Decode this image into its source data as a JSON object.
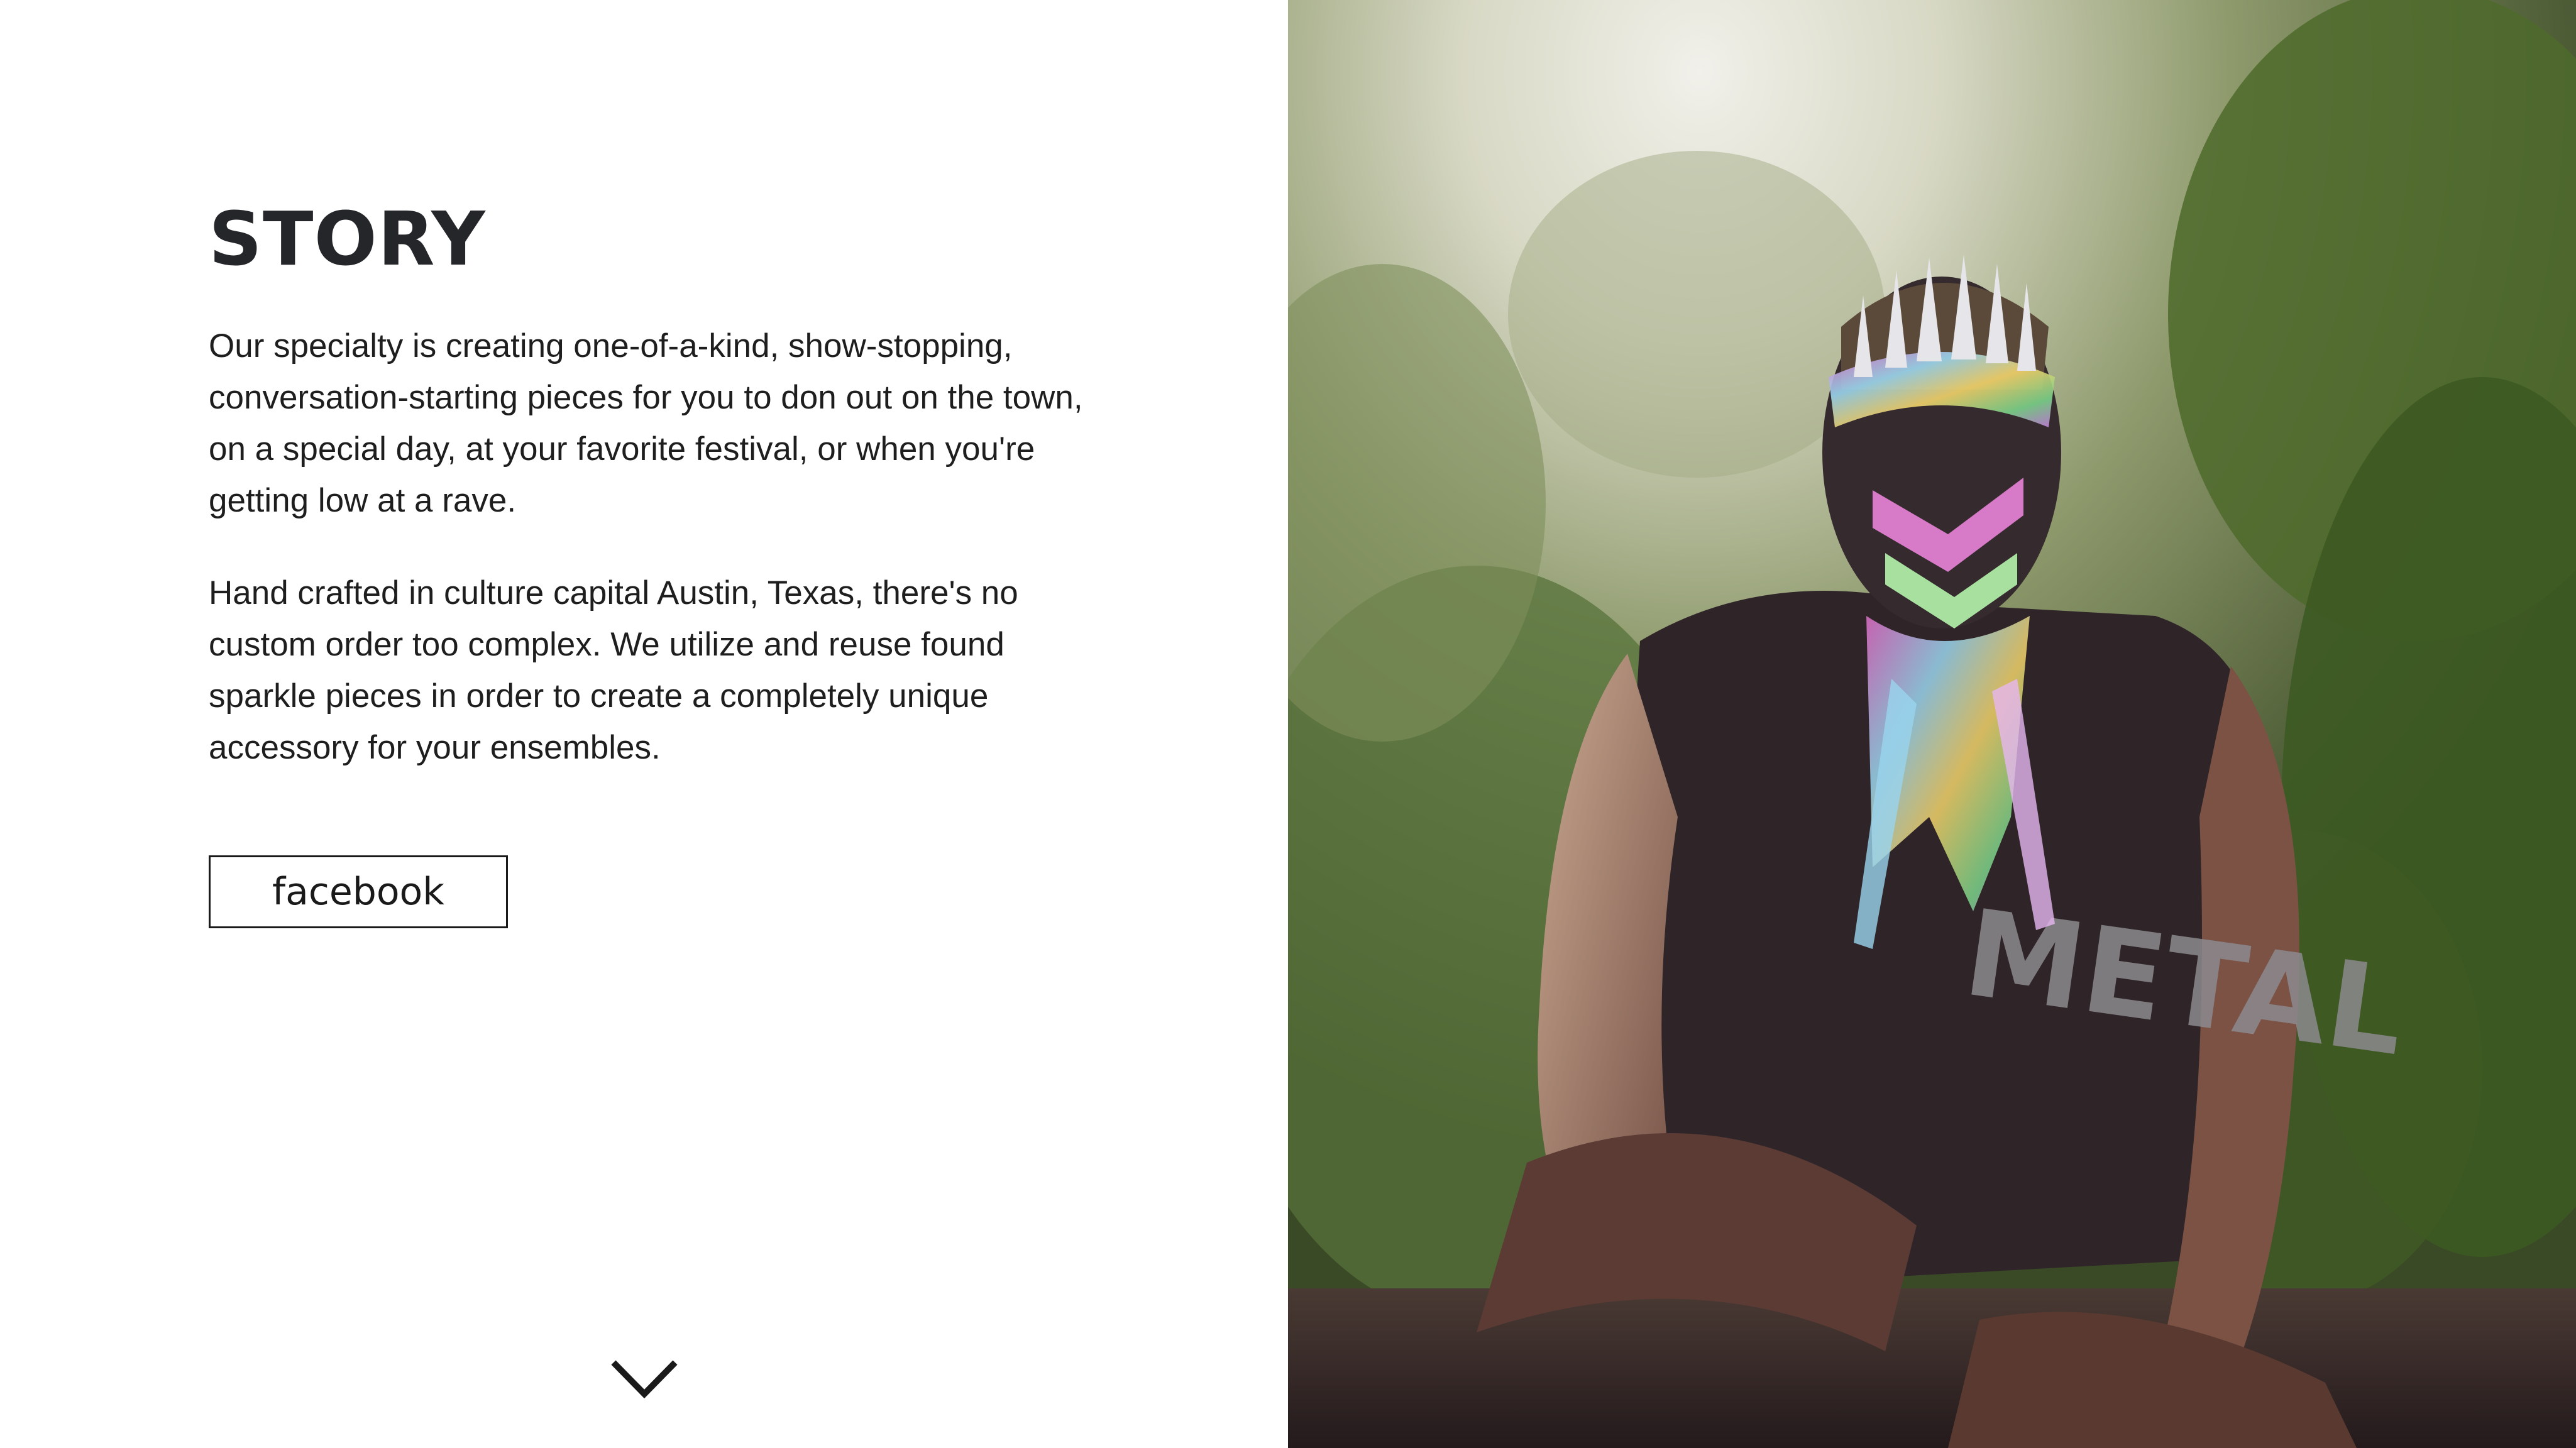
{
  "story": {
    "title": "STORY",
    "paragraph_1": "Our specialty is creating one-of-a-kind, show-stopping, conversation-starting pieces for you to don out on the town, on a special day, at your favorite festival, or when you're getting low at a rave.",
    "paragraph_2": "Hand crafted in culture capital Austin, Texas, there's no custom order too complex. We utilize and reuse found sparkle pieces in order to create a completely unique accessory for your ensembles.",
    "facebook_label": "facebook"
  },
  "scroll": {
    "icon": "chevron-down-icon"
  },
  "photo": {
    "shirt_text": "METAL"
  },
  "colors": {
    "text_dark": "#24262a",
    "body_text": "#1e1e1e",
    "background": "#ffffff"
  }
}
